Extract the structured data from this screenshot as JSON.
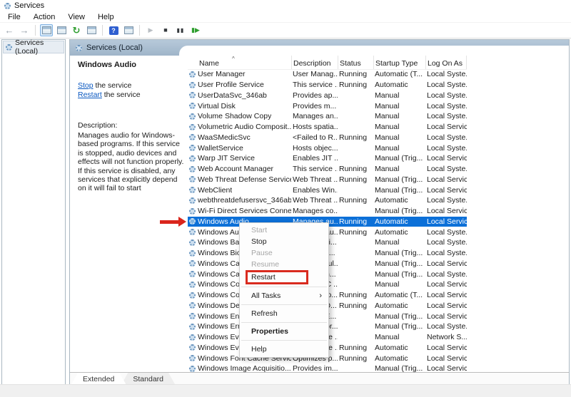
{
  "window": {
    "title": "Services"
  },
  "menubar": {
    "items": [
      "File",
      "Action",
      "View",
      "Help"
    ]
  },
  "toolbar": {
    "icons": [
      {
        "name": "back-icon",
        "glyph": "←",
        "style": "nav"
      },
      {
        "name": "forward-icon",
        "glyph": "→",
        "style": "nav"
      },
      {
        "name": "separator",
        "style": "sep"
      },
      {
        "name": "show-console-tree-icon",
        "style": "winbox",
        "active": true
      },
      {
        "name": "properties-window-icon",
        "style": "winbox"
      },
      {
        "name": "refresh-icon",
        "glyph": "↻",
        "style": "green"
      },
      {
        "name": "export-list-icon",
        "style": "winbox"
      },
      {
        "name": "separator",
        "style": "sep"
      },
      {
        "name": "help-icon",
        "glyph": "?",
        "style": "help"
      },
      {
        "name": "extended-pane-icon",
        "style": "winbox"
      },
      {
        "name": "separator",
        "style": "sep"
      },
      {
        "name": "start-service-icon",
        "glyph": "▶",
        "style": "play"
      },
      {
        "name": "stop-service-icon",
        "glyph": "■",
        "style": "stop"
      },
      {
        "name": "pause-service-icon",
        "glyph": "▮▮",
        "style": "pause"
      },
      {
        "name": "restart-service-icon",
        "glyph": "▮▶",
        "style": "restart"
      }
    ]
  },
  "sidebar": {
    "root_label": "Services (Local)"
  },
  "panel": {
    "header_title": "Services (Local)"
  },
  "info": {
    "service_name": "Windows Audio",
    "links": [
      {
        "text": "Stop",
        "suffix": " the service"
      },
      {
        "text": "Restart",
        "suffix": " the service"
      }
    ],
    "description_label": "Description:",
    "description": "Manages audio for Windows-based programs.  If this service is stopped, audio devices and effects will not function properly.  If this service is disabled, any services that explicitly depend on it will fail to start"
  },
  "table": {
    "columns": [
      "Name",
      "Description",
      "Status",
      "Startup Type",
      "Log On As"
    ],
    "sort_indicator": "^",
    "rows": [
      {
        "n": "User Manager",
        "d": "User Manag...",
        "s": "Running",
        "t": "Automatic (T...",
        "l": "Local Syste..."
      },
      {
        "n": "User Profile Service",
        "d": "This service ...",
        "s": "Running",
        "t": "Automatic",
        "l": "Local Syste..."
      },
      {
        "n": "UserDataSvc_346ab",
        "d": "Provides ap...",
        "s": "",
        "t": "Manual",
        "l": "Local Syste..."
      },
      {
        "n": "Virtual Disk",
        "d": "Provides m...",
        "s": "",
        "t": "Manual",
        "l": "Local Syste..."
      },
      {
        "n": "Volume Shadow Copy",
        "d": "Manages an...",
        "s": "",
        "t": "Manual",
        "l": "Local Syste..."
      },
      {
        "n": "Volumetric Audio Composit...",
        "d": "Hosts spatia...",
        "s": "",
        "t": "Manual",
        "l": "Local Service"
      },
      {
        "n": "WaaSMedicSvc",
        "d": "<Failed to R...",
        "s": "Running",
        "t": "Manual",
        "l": "Local Syste..."
      },
      {
        "n": "WalletService",
        "d": "Hosts objec...",
        "s": "",
        "t": "Manual",
        "l": "Local Syste..."
      },
      {
        "n": "Warp JIT Service",
        "d": "Enables JIT ...",
        "s": "",
        "t": "Manual (Trig...",
        "l": "Local Service"
      },
      {
        "n": "Web Account Manager",
        "d": "This service ...",
        "s": "Running",
        "t": "Manual",
        "l": "Local Syste..."
      },
      {
        "n": "Web Threat Defense Service",
        "d": "Web Threat ...",
        "s": "Running",
        "t": "Manual (Trig...",
        "l": "Local Service"
      },
      {
        "n": "WebClient",
        "d": "Enables Win...",
        "s": "",
        "t": "Manual (Trig...",
        "l": "Local Service"
      },
      {
        "n": "webthreatdefusersvc_346ab",
        "d": "Web Threat ...",
        "s": "Running",
        "t": "Automatic",
        "l": "Local Syste..."
      },
      {
        "n": "Wi-Fi Direct Services Conne...",
        "d": "Manages co...",
        "s": "",
        "t": "Manual (Trig...",
        "l": "Local Service"
      },
      {
        "n": "Windows Audio",
        "d": "Manages au...",
        "s": "Running",
        "t": "Automatic",
        "l": "Local Service",
        "sel": true
      },
      {
        "n": "Windows Audio Endpoint B...",
        "d": "Manages au...",
        "s": "Running",
        "t": "Automatic",
        "l": "Local Syste..."
      },
      {
        "n": "Windows Backup",
        "d": "Provides Vi...",
        "s": "",
        "t": "Manual",
        "l": "Local Syste..."
      },
      {
        "n": "Windows Biometric Service",
        "d": "The Windo...",
        "s": "",
        "t": "Manual (Trig...",
        "l": "Local Syste..."
      },
      {
        "n": "Windows Camera Frame S...",
        "d": "Enables mul...",
        "s": "",
        "t": "Manual (Trig...",
        "l": "Local Service"
      },
      {
        "n": "Windows Camera Frame S...",
        "d": "Monitors th...",
        "s": "",
        "t": "Manual (Trig...",
        "l": "Local Syste..."
      },
      {
        "n": "Windows Connect Now - C...",
        "d": "WCNCSVC ...",
        "s": "",
        "t": "Manual",
        "l": "Local Service"
      },
      {
        "n": "Windows Connection Mana...",
        "d": "Makes auto...",
        "s": "Running",
        "t": "Automatic (T...",
        "l": "Local Service"
      },
      {
        "n": "Windows Defender Firewall",
        "d": "Windows D...",
        "s": "Running",
        "t": "Automatic",
        "l": "Local Service"
      },
      {
        "n": "Windows Encryption Provid...",
        "d": "Windows E...",
        "s": "",
        "t": "Manual (Trig...",
        "l": "Local Service"
      },
      {
        "n": "Windows Error Reporting S...",
        "d": "Allows error...",
        "s": "",
        "t": "Manual (Trig...",
        "l": "Local Syste..."
      },
      {
        "n": "Windows Event Collector",
        "d": "This service ...",
        "s": "",
        "t": "Manual",
        "l": "Network S..."
      },
      {
        "n": "Windows Event Log",
        "d": "This service ...",
        "s": "Running",
        "t": "Automatic",
        "l": "Local Service"
      },
      {
        "n": "Windows Font Cache Service",
        "d": "Optimizes p...",
        "s": "Running",
        "t": "Automatic",
        "l": "Local Service"
      },
      {
        "n": "Windows Image Acquisitio...",
        "d": "Provides im...",
        "s": "",
        "t": "Manual (Trig...",
        "l": "Local Service"
      }
    ]
  },
  "context_menu": {
    "items": [
      {
        "type": "item",
        "label": "Start",
        "disabled": true
      },
      {
        "type": "item",
        "label": "Stop"
      },
      {
        "type": "item",
        "label": "Pause",
        "disabled": true
      },
      {
        "type": "item",
        "label": "Resume",
        "disabled": true
      },
      {
        "type": "item",
        "label": "Restart",
        "boxed": true
      },
      {
        "type": "sep"
      },
      {
        "type": "item",
        "label": "All Tasks",
        "submenu": true,
        "big": true
      },
      {
        "type": "sep"
      },
      {
        "type": "item",
        "label": "Refresh",
        "big": true
      },
      {
        "type": "sep"
      },
      {
        "type": "item",
        "label": "Properties",
        "bold": true,
        "big": true
      },
      {
        "type": "sep"
      },
      {
        "type": "item",
        "label": "Help",
        "big": true
      }
    ]
  },
  "tabs": {
    "items": [
      {
        "label": "Extended",
        "active": true
      },
      {
        "label": "Standard",
        "active": false
      }
    ]
  },
  "colors": {
    "selection_blue": "#0c70d8",
    "annotation_red": "#da251c",
    "link_blue": "#0a58c0",
    "panel_header_blue": "#a9bdd0"
  }
}
